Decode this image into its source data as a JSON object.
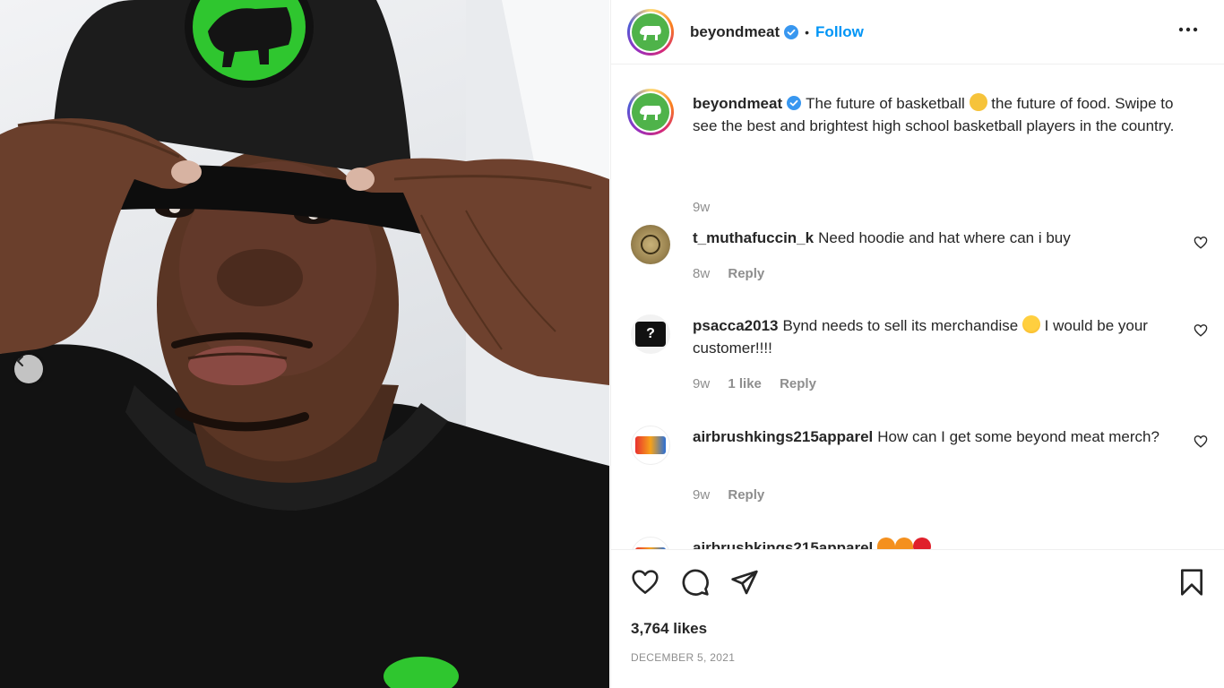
{
  "post": {
    "username": "beyondmeat",
    "verified": true,
    "separator": "•",
    "follow_label": "Follow",
    "more_icon": "more-options-icon"
  },
  "caption": {
    "username": "beyondmeat",
    "text_before_emoji": "The future of basketball",
    "emoji": "handshake",
    "text_after_emoji": "the future of food. Swipe to see the best and brightest high school basketball players in the country.",
    "age": "9w"
  },
  "comments": [
    {
      "username": "t_muthafuccin_k",
      "text": "Need hoodie and hat where can i buy",
      "age": "8w",
      "likes": "",
      "reply_label": "Reply"
    },
    {
      "username": "psacca2013",
      "text_before_emoji": "Bynd needs to sell its merchandise",
      "emoji": "star-struck",
      "text_after_emoji": "I would be your customer!!!!",
      "age": "9w",
      "likes": "1 like",
      "reply_label": "Reply"
    },
    {
      "username": "airbrushkings215apparel",
      "text": "How can I get some beyond meat merch?",
      "age": "9w",
      "likes": "",
      "reply_label": "Reply"
    },
    {
      "username": "airbrushkings215apparel",
      "text": "",
      "emojis": [
        "fire",
        "fire",
        "red-heart"
      ]
    }
  ],
  "stats": {
    "likes": "3,764 likes",
    "date": "DECEMBER 5, 2021"
  },
  "colors": {
    "link_blue": "#0095f6",
    "brand_green": "#4fb34a",
    "verified_blue": "#3897f0",
    "muted_text": "#8e8e8e"
  }
}
